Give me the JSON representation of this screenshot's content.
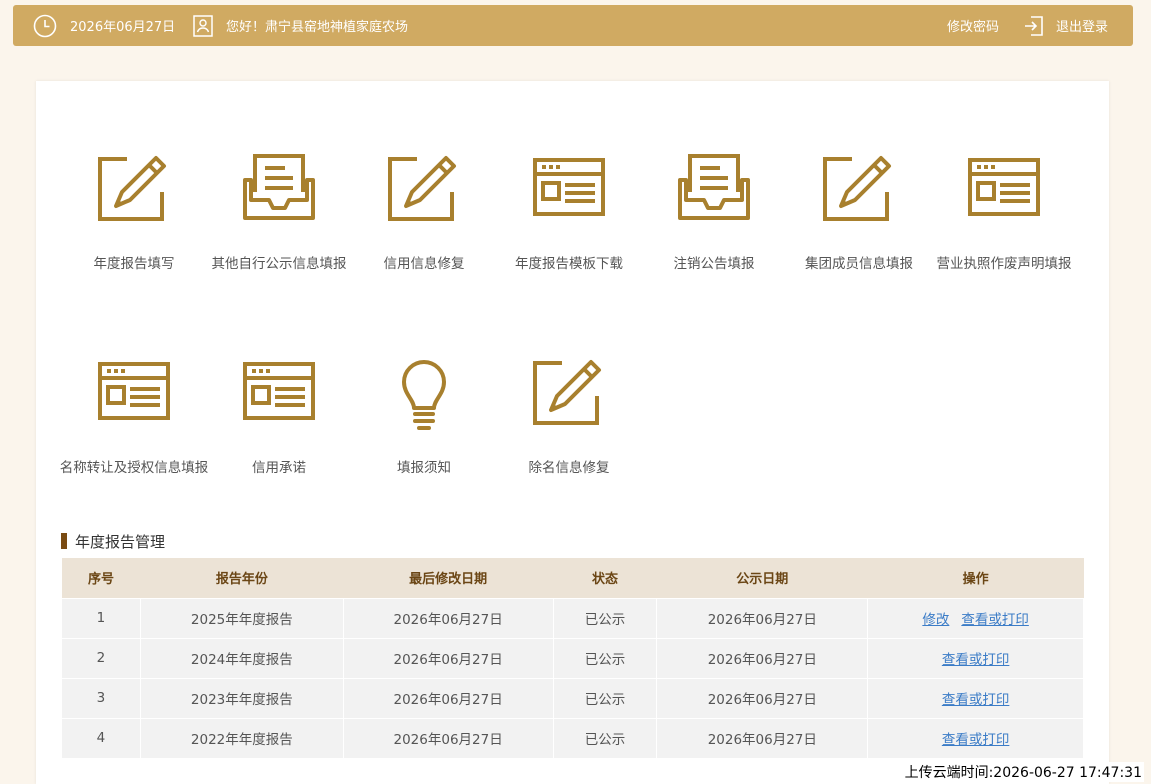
{
  "header": {
    "date": "2026年06月27日",
    "greeting": "您好！肃宁县窑地神植家庭农场",
    "change_password": "修改密码",
    "logout": "退出登录",
    "icons": {
      "date": "clock-icon",
      "user": "user-badge-icon",
      "logout": "logout-icon"
    }
  },
  "tiles": [
    {
      "label": "年度报告填写",
      "icon": "edit-pencil-icon"
    },
    {
      "label": "其他自行公示信息填报",
      "icon": "inbox-document-icon"
    },
    {
      "label": "信用信息修复",
      "icon": "edit-pencil-icon"
    },
    {
      "label": "年度报告模板下载",
      "icon": "browser-window-icon"
    },
    {
      "label": "注销公告填报",
      "icon": "inbox-document-icon"
    },
    {
      "label": "集团成员信息填报",
      "icon": "edit-pencil-icon"
    },
    {
      "label": "营业执照作废声明填报",
      "icon": "browser-window-icon"
    },
    {
      "label": "名称转让及授权信息填报",
      "icon": "browser-window-icon"
    },
    {
      "label": "信用承诺",
      "icon": "browser-window-icon"
    },
    {
      "label": "填报须知",
      "icon": "lightbulb-icon"
    },
    {
      "label": "除名信息修复",
      "icon": "edit-pencil-icon"
    }
  ],
  "annual_report": {
    "title": "年度报告管理",
    "columns": [
      "序号",
      "报告年份",
      "最后修改日期",
      "状态",
      "公示日期",
      "操作"
    ],
    "rows": [
      {
        "no": "1",
        "year": "2025年年度报告",
        "modified": "2026年06月27日",
        "status": "已公示",
        "published": "2026年06月27日",
        "actions": [
          "修改",
          "查看或打印"
        ]
      },
      {
        "no": "2",
        "year": "2024年年度报告",
        "modified": "2026年06月27日",
        "status": "已公示",
        "published": "2026年06月27日",
        "actions": [
          "查看或打印"
        ]
      },
      {
        "no": "3",
        "year": "2023年年度报告",
        "modified": "2026年06月27日",
        "status": "已公示",
        "published": "2026年06月27日",
        "actions": [
          "查看或打印"
        ]
      },
      {
        "no": "4",
        "year": "2022年年度报告",
        "modified": "2026年06月27日",
        "status": "已公示",
        "published": "2026年06月27日",
        "actions": [
          "查看或打印"
        ]
      }
    ]
  },
  "footer": {
    "upload_time": "上传云端时间:2026-06-27 17:47:31"
  },
  "colors": {
    "gold": "#d0aa62",
    "icon_brown": "#a8802e",
    "header_bg": "#ece3d6",
    "link": "#3b7cc7"
  }
}
